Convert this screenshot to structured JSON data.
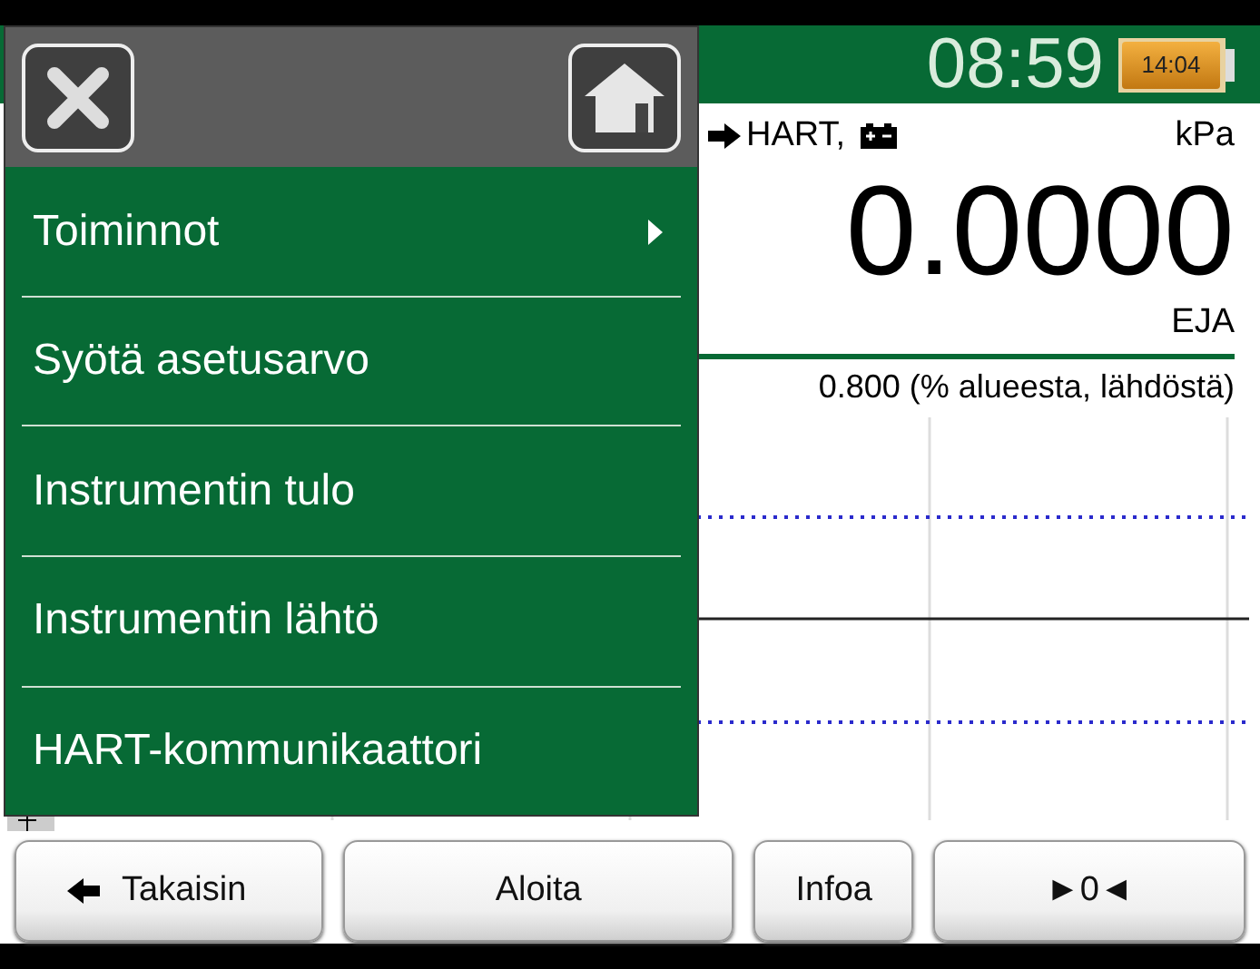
{
  "status": {
    "time": "08:59",
    "battery_time": "14:04"
  },
  "readout": {
    "source": "HART,",
    "unit": "kPa",
    "value": "0.0000",
    "device": "EJA",
    "range_text": "0.800 (% alueesta, lähdöstä)"
  },
  "menu": {
    "items": [
      {
        "label": "Toiminnot",
        "kind": "submenu"
      },
      {
        "label": "Syötä asetusarvo",
        "kind": "action"
      },
      {
        "label": "Instrumentin tulo",
        "kind": "action"
      },
      {
        "label": "Instrumentin lähtö",
        "kind": "action"
      },
      {
        "label": "HART-kommunikaattori",
        "kind": "action"
      }
    ]
  },
  "buttons": [
    {
      "label": "Takaisin",
      "kind": "back"
    },
    {
      "label": "Aloita",
      "kind": "plain"
    },
    {
      "label": "Infoa",
      "kind": "plain"
    },
    {
      "label": "►0◄",
      "kind": "plain"
    }
  ]
}
